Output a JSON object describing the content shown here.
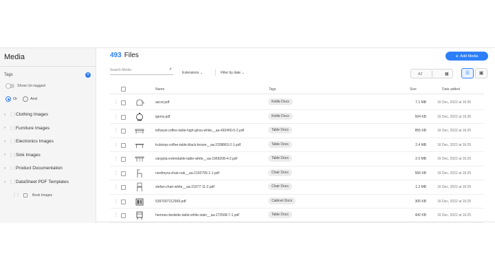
{
  "sidebar": {
    "title": "Media",
    "tags_label": "Tags",
    "show_untagged": "Show Un-tagged",
    "radio_or": "Or",
    "radio_and": "And",
    "folders": [
      {
        "label": "Clothing Images"
      },
      {
        "label": "Furniture Images"
      },
      {
        "label": "Electronics Images"
      },
      {
        "label": "Sink Images"
      },
      {
        "label": "Product Documentation"
      },
      {
        "label": "DataSheet PDF Templates"
      }
    ],
    "sub_folder": "Book Images"
  },
  "header": {
    "file_count": "493",
    "files_label": "Files",
    "add_media": "Add Media"
  },
  "toolbar": {
    "search_placeholder": "Search Media",
    "extensions": "Extensions",
    "filter_date": "Filter by date",
    "sort_label": "AZ"
  },
  "table": {
    "headers": {
      "name": "Name",
      "tags": "Tags",
      "size": "Size",
      "date": "Date added"
    },
    "rows": [
      {
        "name": "ascot.pdf",
        "tag": "Kettle Docs",
        "size": "7.1 MB",
        "date": "16 Dec, 2022 at 16:35"
      },
      {
        "name": "igenis.pdf",
        "tag": "Kettle Docs",
        "size": "504 KB",
        "date": "16 Dec, 2022 at 16:35"
      },
      {
        "name": "toftaryd-coffee-table-high-gloss-white__aa-492460-5-2.pdf",
        "tag": "Table Docs",
        "size": "855 KB",
        "date": "16 Dec, 2022 at 16:25"
      },
      {
        "name": "trulstorp-coffee-table-black-brown__aa-2208863-2-1.pdf",
        "tag": "Table Docs",
        "size": "2.4 MB",
        "date": "16 Dec, 2022 at 16:25"
      },
      {
        "name": "vangsta-extendable-table-white__aa-1969208-4-2.pdf",
        "tag": "Table Docs",
        "size": "2.0 MB",
        "date": "16 Dec, 2022 at 16:25"
      },
      {
        "name": "nordmyra-chair-oak__aa-2192795-1-1.pdf",
        "tag": "Chair Docs",
        "size": "556 KB",
        "date": "16 Dec, 2022 at 16:25"
      },
      {
        "name": "stefan-chair-white__aa-21977-11-2.pdf",
        "tag": "Chair Docs",
        "size": "1.2 MB",
        "date": "16 Dec, 2022 at 16:25"
      },
      {
        "name": "5397007212969.pdf",
        "tag": "Cabinet Docs",
        "size": "305 KB",
        "date": "16 Dec, 2022 at 16:25"
      },
      {
        "name": "hemnes-bedside-table-white-stain__aa-272568-7-1.pdf",
        "tag": "Table Docs",
        "size": "442 KB",
        "date": "16 Dec, 2022 at 16:25"
      }
    ]
  },
  "icons": {
    "search": "search-icon",
    "add": "plus-icon",
    "calendar": "calendar-icon",
    "list_view": "list-view-icon",
    "grid_view": "grid-view-icon",
    "drag": "drag-handle-icon",
    "chevron": "chevron-right-icon"
  },
  "colors": {
    "accent": "#2d7ff9",
    "sidebar_bg": "#f5f5f5",
    "tag_bg": "#ececec"
  }
}
